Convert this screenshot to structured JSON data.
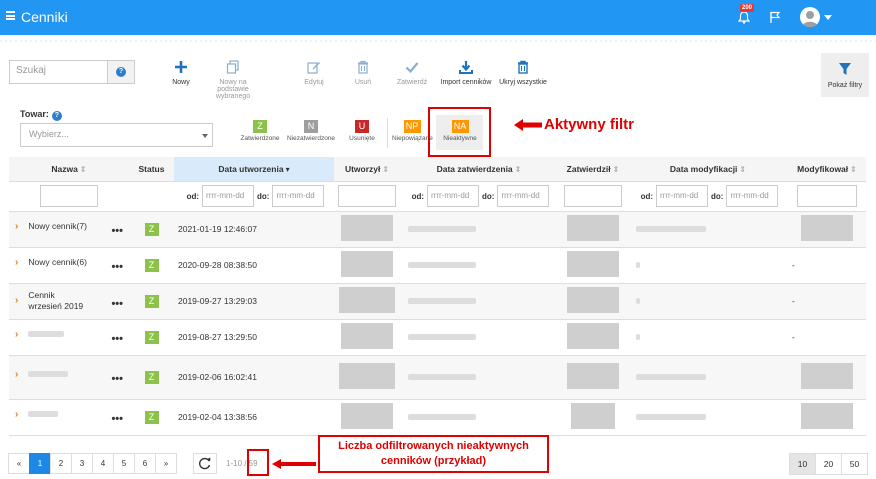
{
  "header": {
    "title": "Cenniki",
    "notification_count": "200"
  },
  "search": {
    "placeholder": "Szukaj",
    "help": "?"
  },
  "toolbar": {
    "nowy": "Nowy",
    "nowy_na_podstawie": "Nowy na podstawie wybranego",
    "edytuj": "Edytuj",
    "usun": "Usuń",
    "zatwierdz": "Zatwierdź",
    "import": "Import cenników",
    "ukryj": "Ukryj wszystkie",
    "pokaz_filtry": "Pokaż filtry"
  },
  "towar": {
    "label": "Towar:",
    "help": "?",
    "placeholder": "Wybierz..."
  },
  "status_filters": [
    {
      "code": "Z",
      "label": "Zatwierdzone",
      "color": "#8bc34a"
    },
    {
      "code": "N",
      "label": "Niezatwierdzone",
      "color": "#9e9e9e"
    },
    {
      "code": "U",
      "label": "Usunięte",
      "color": "#c62828"
    },
    {
      "code": "NP",
      "label": "Niepowiązane",
      "color": "#ff9800"
    },
    {
      "code": "NA",
      "label": "Nieaktywne",
      "color": "#ff9800"
    }
  ],
  "annotations": {
    "active_filter": "Aktywny filtr",
    "filtered_count_line1": "Liczba odfiltrowanych nieaktywnych",
    "filtered_count_line2": "cenników (przykład)"
  },
  "table": {
    "columns": [
      "Nazwa",
      "Status",
      "Data utworzenia",
      "Utworzył",
      "Data zatwierdzenia",
      "Zatwierdził",
      "Data modyfikacji",
      "Modyfikował"
    ],
    "filter_from": "od:",
    "filter_to": "do:",
    "date_placeholder": "rrrr-mm-dd",
    "rows": [
      {
        "name": "Nowy cennik(7)",
        "status": "Z",
        "created": "2021-01-19 12:46:07",
        "modified_by": ""
      },
      {
        "name": "Nowy cennik(6)",
        "status": "Z",
        "created": "2020-09-28 08:38:50",
        "modified_by": "-"
      },
      {
        "name": "Cennik wrzesień 2019",
        "status": "Z",
        "created": "2019-09-27 13:29:03",
        "modified_by": "-"
      },
      {
        "name": "",
        "status": "Z",
        "created": "2019-08-27 13:29:50",
        "modified_by": "-"
      },
      {
        "name": "",
        "status": "Z",
        "created": "2019-02-06 16:02:41",
        "modified_by": ""
      },
      {
        "name": "",
        "status": "Z",
        "created": "2019-02-04 13:38:56",
        "modified_by": ""
      }
    ]
  },
  "pagination": {
    "prev": "«",
    "next": "»",
    "pages": [
      "1",
      "2",
      "3",
      "4",
      "5",
      "6"
    ],
    "range_info": "1-10 / 59",
    "sizes": [
      "10",
      "20",
      "50"
    ]
  }
}
